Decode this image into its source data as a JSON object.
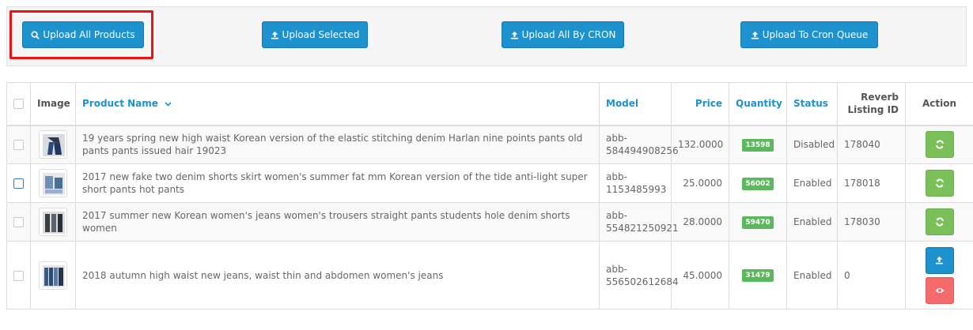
{
  "toolbar": {
    "buttons": [
      {
        "label": "Upload All Products",
        "icon": "search-icon"
      },
      {
        "label": "Upload Selected",
        "icon": "upload-icon"
      },
      {
        "label": "Upload All By CRON",
        "icon": "upload-icon"
      },
      {
        "label": "Upload To Cron Queue",
        "icon": "upload-icon"
      }
    ]
  },
  "table": {
    "headers": {
      "image": "Image",
      "product_name": "Product Name",
      "model": "Model",
      "price": "Price",
      "quantity": "Quantity",
      "status": "Status",
      "listing_line1": "Reverb",
      "listing_line2": "Listing ID",
      "action": "Action"
    },
    "rows": [
      {
        "name": "19 years spring new high waist Korean version of the elastic stitching denim Harlan nine points pants old pants pants issued hair 19023",
        "model_line1": "abb-",
        "model_line2": "584494908256",
        "price": "132.0000",
        "quantity": "13598",
        "status": "Disabled",
        "listing_id": "178040"
      },
      {
        "name": "2017 new fake two denim shorts skirt women's summer fat mm Korean version of the tide anti-light super short pants hot pants",
        "model_line1": "abb-",
        "model_line2": "1153485993",
        "price": "25.0000",
        "quantity": "56002",
        "status": "Enabled",
        "listing_id": "178018"
      },
      {
        "name": "2017 summer new Korean women's jeans women's trousers straight pants students hole denim shorts women",
        "model_line1": "abb-",
        "model_line2": "554821250921",
        "price": "28.0000",
        "quantity": "59470",
        "status": "Enabled",
        "listing_id": "178030"
      },
      {
        "name": "2018 autumn high waist new jeans, waist thin and abdomen women's jeans",
        "model_line1": "abb-",
        "model_line2": "556502612684",
        "price": "45.0000",
        "quantity": "31479",
        "status": "Enabled",
        "listing_id": "0"
      }
    ]
  },
  "colors": {
    "primary": "#1e91cf",
    "success": "#7bbf59",
    "badge": "#5cb85c",
    "danger": "#f56b6b",
    "highlight": "#e8141a"
  }
}
